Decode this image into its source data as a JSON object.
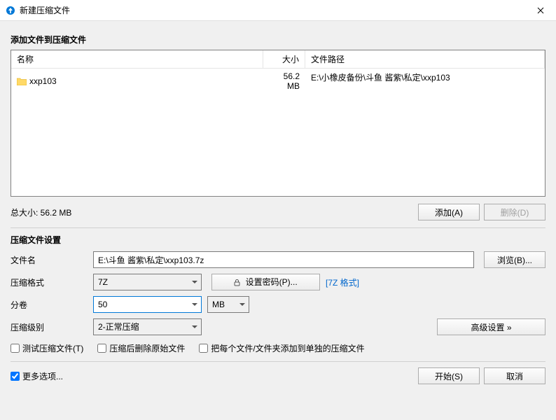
{
  "titlebar": {
    "title": "新建压缩文件"
  },
  "section_add": {
    "title": "添加文件到压缩文件"
  },
  "table": {
    "headers": {
      "name": "名称",
      "size": "大小",
      "path": "文件路径"
    },
    "rows": [
      {
        "name": "xxp103",
        "size": "56.2 MB",
        "path": "E:\\小橡皮备份\\斗鱼 酱紫\\私定\\xxp103"
      }
    ]
  },
  "totals": {
    "label": "总大小: 56.2 MB"
  },
  "buttons": {
    "add": "添加(A)",
    "remove": "删除(D)",
    "browse": "浏览(B)...",
    "set_password": "设置密码(P)...",
    "advanced": "高级设置 »",
    "start": "开始(S)",
    "cancel": "取消"
  },
  "settings": {
    "title": "压缩文件设置",
    "filename_label": "文件名",
    "filename_value": "E:\\斗鱼 酱紫\\私定\\xxp103.7z",
    "format_label": "压缩格式",
    "format_value": "7Z",
    "format_link": "[7Z 格式]",
    "volume_label": "分卷",
    "volume_value": "50",
    "volume_unit": "MB",
    "level_label": "压缩级别",
    "level_value": "2-正常压缩"
  },
  "checkboxes": {
    "test": "测试压缩文件(T)",
    "delete_after": "压缩后删除原始文件",
    "each_separate": "把每个文件/文件夹添加到单独的压缩文件",
    "more_options": "更多选项..."
  }
}
